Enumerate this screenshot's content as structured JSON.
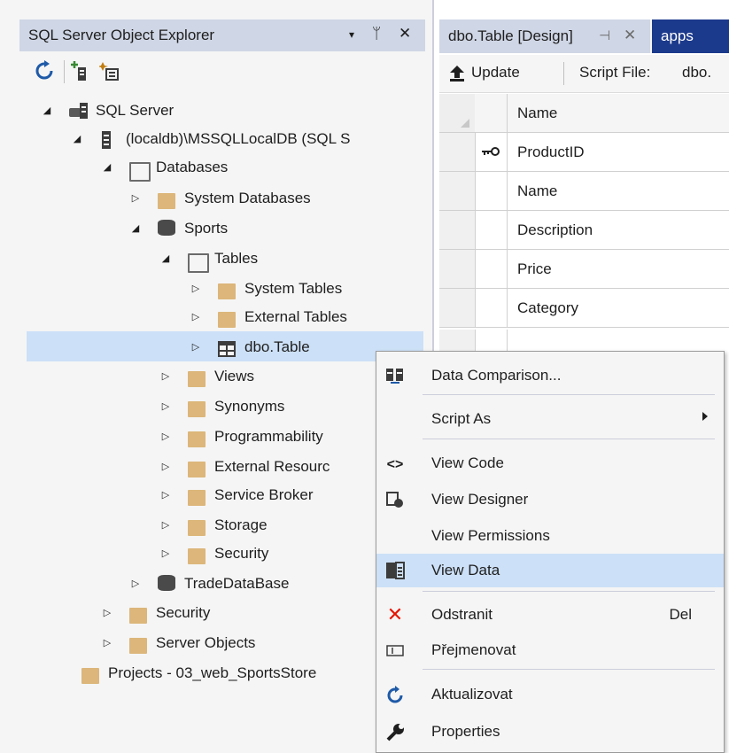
{
  "explorer": {
    "title": "SQL Server Object Explorer",
    "controls": [
      "▾",
      "ᛘ",
      "✕"
    ],
    "tree": [
      {
        "label": "SQL Server",
        "arrow": "◢"
      },
      {
        "label": "(localdb)\\MSSQLLocalDB (SQL S",
        "arrow": "◢"
      },
      {
        "label": "Databases",
        "arrow": "◢"
      },
      {
        "label": "System Databases",
        "arrow": "▷"
      },
      {
        "label": "Sports",
        "arrow": "◢"
      },
      {
        "label": "Tables",
        "arrow": "◢"
      },
      {
        "label": "System Tables",
        "arrow": "▷"
      },
      {
        "label": "External Tables",
        "arrow": "▷"
      },
      {
        "label": "dbo.Table",
        "arrow": "▷"
      },
      {
        "label": "Views",
        "arrow": "▷"
      },
      {
        "label": "Synonyms",
        "arrow": "▷"
      },
      {
        "label": "Programmability",
        "arrow": "▷"
      },
      {
        "label": "External Resourc",
        "arrow": "▷"
      },
      {
        "label": "Service Broker",
        "arrow": "▷"
      },
      {
        "label": "Storage",
        "arrow": "▷"
      },
      {
        "label": "Security",
        "arrow": "▷"
      },
      {
        "label": "TradeDataBase",
        "arrow": "▷"
      },
      {
        "label": "Security",
        "arrow": "▷"
      },
      {
        "label": "Server Objects",
        "arrow": "▷"
      },
      {
        "label": "Projects - 03_web_SportsStore",
        "arrow": ""
      }
    ]
  },
  "doc": {
    "tab_active": "dbo.Table [Design]",
    "tab_pin": "⊣",
    "tab_close": "✕",
    "tab_other": "apps",
    "update": "Update",
    "script_file_label": "Script File:",
    "script_file_value": "dbo.",
    "columns_header": "Name",
    "columns": [
      "ProductID",
      "Name",
      "Description",
      "Price",
      "Category"
    ]
  },
  "context_menu": {
    "items": [
      {
        "label": "Data Comparison...",
        "shortcut": "",
        "icon": "data-comparison-icon"
      },
      {
        "label": "Script As",
        "shortcut": "",
        "icon": ""
      },
      {
        "label": "View Code",
        "shortcut": "",
        "icon": "code-icon"
      },
      {
        "label": "View Designer",
        "shortcut": "",
        "icon": "designer-icon"
      },
      {
        "label": "View Permissions",
        "shortcut": "",
        "icon": ""
      },
      {
        "label": "View Data",
        "shortcut": "",
        "icon": "table-data-icon"
      },
      {
        "label": "Odstranit",
        "shortcut": "Del",
        "icon": "delete-x-icon"
      },
      {
        "label": "Přejmenovat",
        "shortcut": "",
        "icon": "rename-icon"
      },
      {
        "label": "Aktualizovat",
        "shortcut": "",
        "icon": "refresh-icon"
      },
      {
        "label": "Properties",
        "shortcut": "",
        "icon": "wrench-icon"
      }
    ]
  },
  "colors": {
    "accent": "#1c3a8c",
    "selection": "#cce0f7",
    "title_bar": "#cfd6e5",
    "delete_red": "#e51400",
    "refresh_blue": "#1e5aa8"
  }
}
